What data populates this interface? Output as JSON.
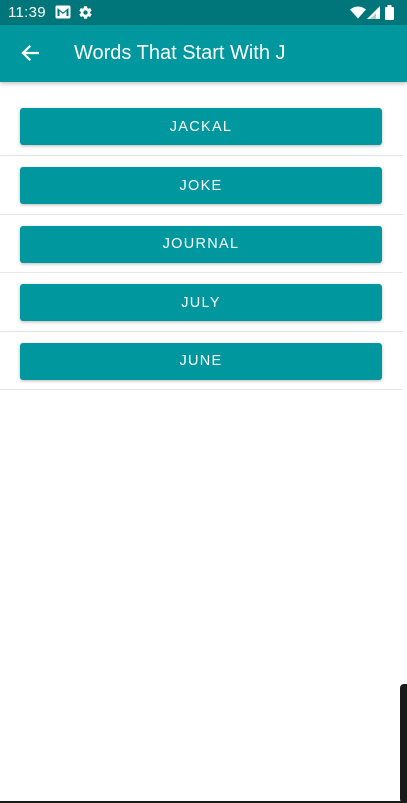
{
  "status_bar": {
    "time": "11:39",
    "left_icons": [
      "gmail-icon",
      "settings-gear-icon"
    ],
    "right_icons": [
      "wifi-icon",
      "cellular-signal-icon",
      "battery-icon"
    ],
    "background_color": "#00767a"
  },
  "app_bar": {
    "title": "Words That Start With J",
    "back_icon": "arrow-left-icon",
    "background_color": "#00979f"
  },
  "words": {
    "items": [
      {
        "label": "JACKAL"
      },
      {
        "label": "JOKE"
      },
      {
        "label": "JOURNAL"
      },
      {
        "label": "JULY"
      },
      {
        "label": "JUNE"
      }
    ],
    "button_color": "#00979f",
    "text_color": "#ffffff"
  }
}
